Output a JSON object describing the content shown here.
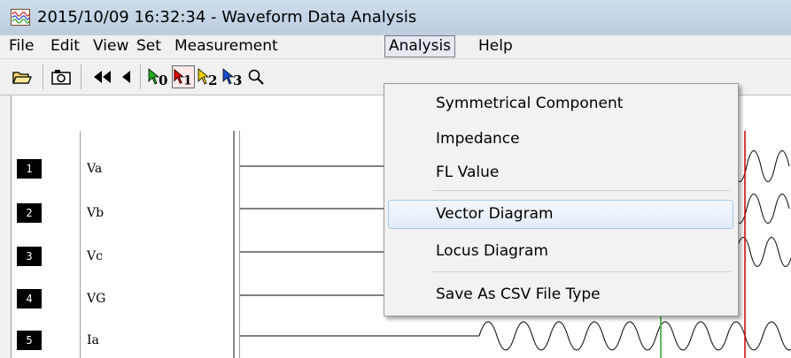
{
  "window": {
    "title": "2015/10/09 16:32:34  - Waveform Data Analysis"
  },
  "menu": [
    {
      "label": "File"
    },
    {
      "label": "Edit"
    },
    {
      "label": "View"
    },
    {
      "label": "Set"
    },
    {
      "label": "Measurement"
    },
    {
      "label": "Analysis"
    },
    {
      "label": "Help"
    }
  ],
  "toolbar": {
    "buttons": [
      "open-folder-icon",
      "camera-icon",
      "rewind-icon",
      "step-back-icon",
      "cursor-0-icon",
      "cursor-1-icon",
      "cursor-2-icon",
      "cursor-3-icon",
      "magnify-icon"
    ],
    "cursor_labels": [
      "0",
      "1",
      "2",
      "3"
    ]
  },
  "channels": [
    {
      "num": "1",
      "name": "Va"
    },
    {
      "num": "2",
      "name": "Vb"
    },
    {
      "num": "3",
      "name": "Vc"
    },
    {
      "num": "4",
      "name": "VG"
    },
    {
      "num": "5",
      "name": "Ia"
    }
  ],
  "analysis_menu": {
    "items": [
      {
        "label": "Symmetrical Component"
      },
      {
        "label": "Impedance"
      },
      {
        "label": "FL Value"
      },
      {
        "label": "Vector Diagram"
      },
      {
        "label": "Locus Diagram"
      },
      {
        "label": "Save As CSV File Type"
      }
    ],
    "highlighted": "Vector Diagram"
  },
  "colors": {
    "cursor_red": "#d40000",
    "cursor_green": "#22aa22",
    "cursor_yellow": "#e8d000",
    "cursor_blue": "#1a50d0"
  }
}
